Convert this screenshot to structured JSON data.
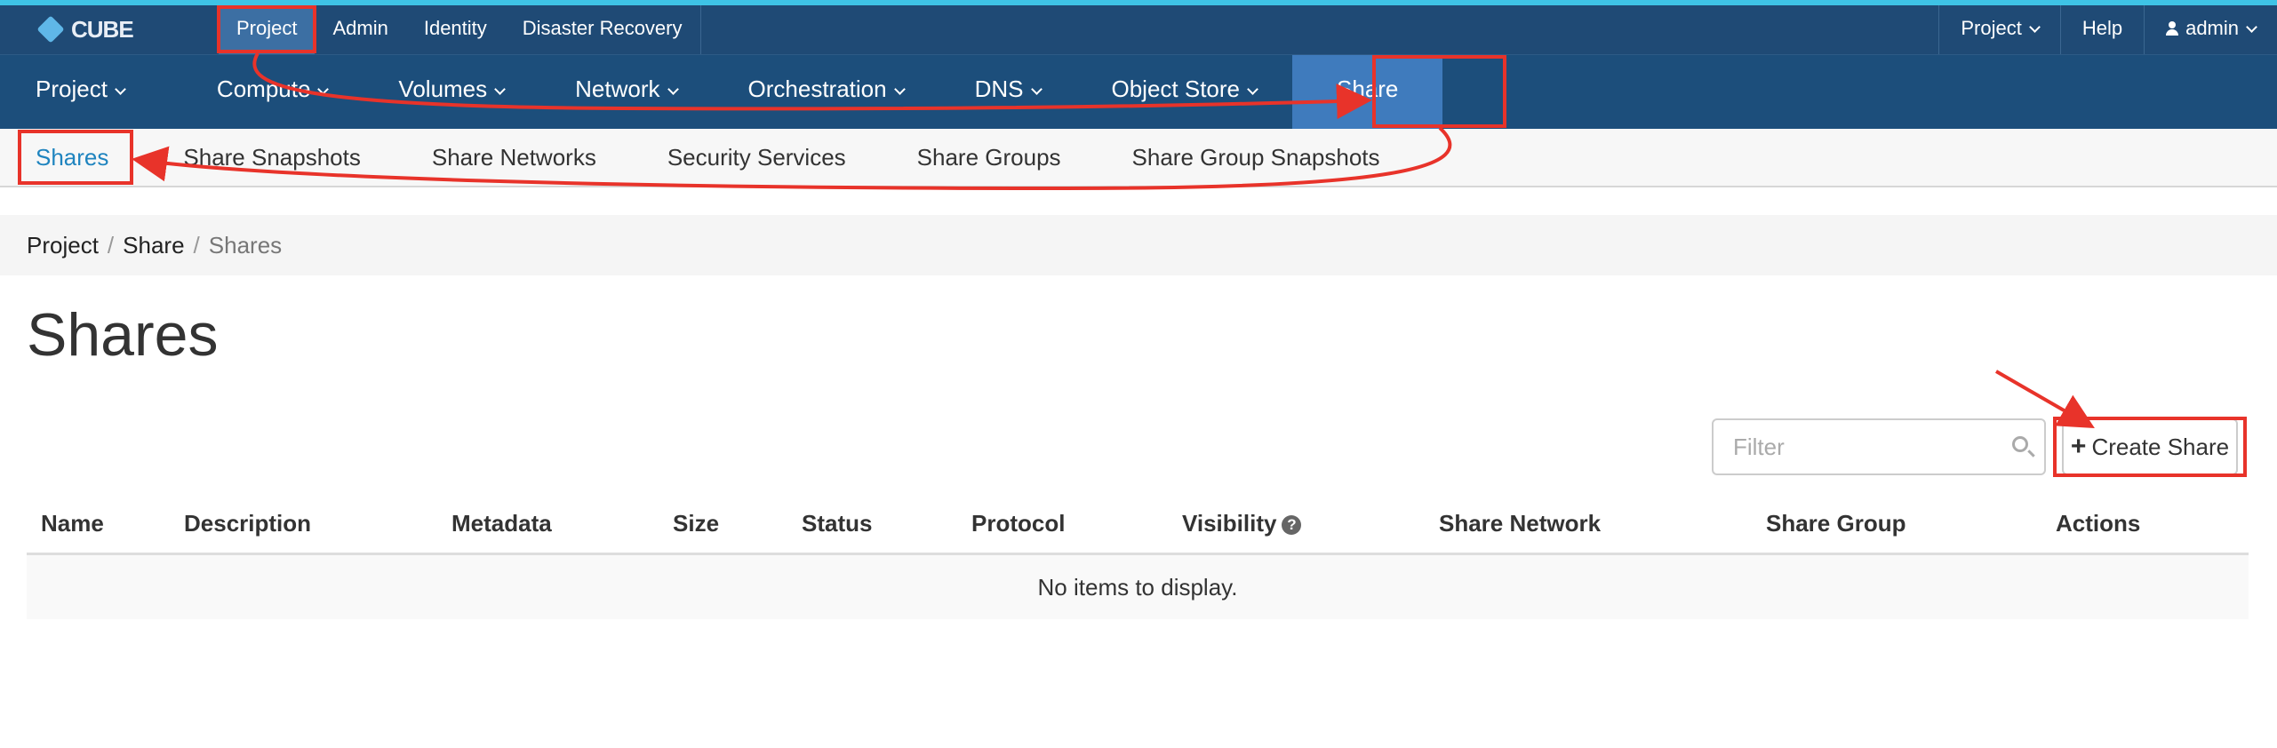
{
  "app": {
    "logo_text": "CUBE"
  },
  "topbar": {
    "left_items": [
      {
        "label": "Project",
        "active": true
      },
      {
        "label": "Admin"
      },
      {
        "label": "Identity"
      },
      {
        "label": "Disaster Recovery"
      }
    ],
    "right_items": {
      "project": "Project",
      "help": "Help",
      "user": "admin"
    }
  },
  "mainnav": {
    "items": [
      {
        "label": "Project"
      },
      {
        "label": "Compute"
      },
      {
        "label": "Volumes"
      },
      {
        "label": "Network"
      },
      {
        "label": "Orchestration"
      },
      {
        "label": "DNS"
      },
      {
        "label": "Object Store"
      },
      {
        "label": "Share",
        "active": true
      }
    ]
  },
  "subnav": {
    "items": [
      {
        "label": "Shares",
        "active": true
      },
      {
        "label": "Share Snapshots"
      },
      {
        "label": "Share Networks"
      },
      {
        "label": "Security Services"
      },
      {
        "label": "Share Groups"
      },
      {
        "label": "Share Group Snapshots"
      }
    ]
  },
  "breadcrumb": {
    "items": [
      "Project",
      "Share"
    ],
    "current": "Shares",
    "separator": "/"
  },
  "page": {
    "title": "Shares"
  },
  "toolbar": {
    "filter_placeholder": "Filter",
    "create_label": "Create Share"
  },
  "table": {
    "columns": [
      "Name",
      "Description",
      "Metadata",
      "Size",
      "Status",
      "Protocol",
      "Visibility",
      "Share Network",
      "Share Group",
      "Actions"
    ],
    "empty_message": "No items to display.",
    "help_icon_glyph": "?"
  },
  "colors": {
    "topbar": "#1f4a75",
    "mainnav": "#1c4e7b",
    "active_tab": "#3f7bbd",
    "link": "#1f84bf",
    "annotation": "#e8332a"
  },
  "icons": [
    "chevron-down-icon",
    "user-icon",
    "search-icon",
    "plus-icon",
    "question-circle-icon"
  ]
}
